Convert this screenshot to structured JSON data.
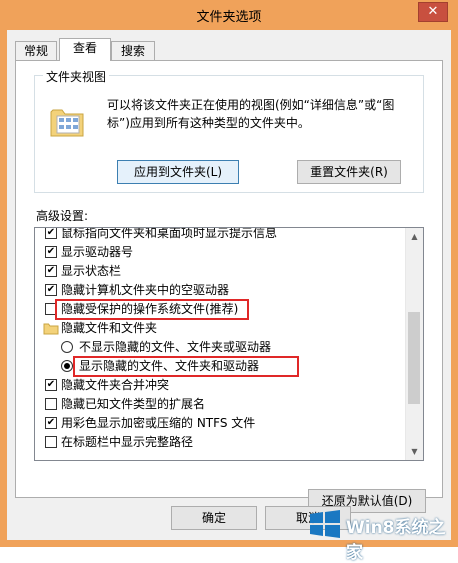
{
  "window": {
    "title": "文件夹选项",
    "close_label": "✕"
  },
  "tabs": [
    {
      "label": "常规"
    },
    {
      "label": "查看"
    },
    {
      "label": "搜索"
    }
  ],
  "folder_views": {
    "group_label": "文件夹视图",
    "description": "可以将该文件夹正在使用的视图(例如“详细信息”或“图标”)应用到所有这种类型的文件夹中。",
    "apply_button": "应用到文件夹(L)",
    "reset_button": "重置文件夹(R)"
  },
  "advanced": {
    "label": "高级设置:",
    "items": [
      {
        "text": "鼠标指向文件夹和桌面项时显示提示信息",
        "type": "checkbox",
        "checked": true
      },
      {
        "text": "显示驱动器号",
        "type": "checkbox",
        "checked": true
      },
      {
        "text": "显示状态栏",
        "type": "checkbox",
        "checked": true
      },
      {
        "text": "隐藏计算机文件夹中的空驱动器",
        "type": "checkbox",
        "checked": true
      },
      {
        "text": "隐藏受保护的操作系统文件(推荐)",
        "type": "checkbox",
        "checked": false
      },
      {
        "text": "隐藏文件和文件夹",
        "type": "folder"
      },
      {
        "text": "不显示隐藏的文件、文件夹或驱动器",
        "type": "radio",
        "checked": false
      },
      {
        "text": "显示隐藏的文件、文件夹和驱动器",
        "type": "radio",
        "checked": true
      },
      {
        "text": "隐藏文件夹合并冲突",
        "type": "checkbox",
        "checked": true
      },
      {
        "text": "隐藏已知文件类型的扩展名",
        "type": "checkbox",
        "checked": false
      },
      {
        "text": "用彩色显示加密或压缩的 NTFS 文件",
        "type": "checkbox",
        "checked": true
      },
      {
        "text": "在标题栏中显示完整路径",
        "type": "checkbox",
        "checked": false
      }
    ],
    "restore_button": "还原为默认值(D)"
  },
  "footer": {
    "ok_button": "确定",
    "cancel_button": "取消"
  },
  "watermark": {
    "text": "Win8系统之家"
  },
  "colors": {
    "highlight": "#e02828",
    "titlebar": "#f0a25a"
  }
}
